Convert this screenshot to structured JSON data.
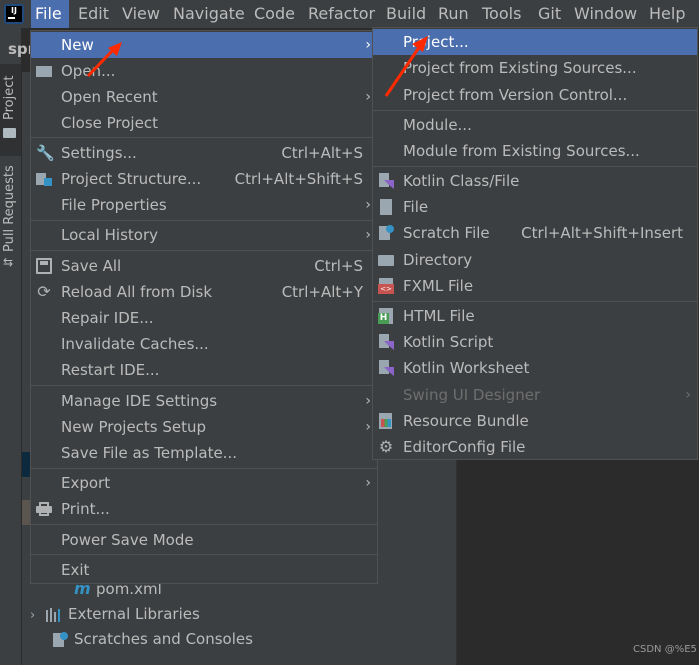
{
  "menubar": {
    "items": [
      "File",
      "Edit",
      "View",
      "Navigate",
      "Code",
      "Refactor",
      "Build",
      "Run",
      "Tools",
      "Git",
      "Window",
      "Help"
    ],
    "active": "File"
  },
  "project": {
    "name": "spr"
  },
  "left_strip": {
    "project_tab": "Project",
    "pull_requests_tab": "Pull Requests"
  },
  "tree": {
    "pom": "pom.xml",
    "external_libraries": "External Libraries",
    "scratches": "Scratches and Consoles"
  },
  "file_menu": {
    "new": "New",
    "open": "Open...",
    "open_recent": "Open Recent",
    "close_project": "Close Project",
    "settings": "Settings...",
    "settings_sc": "Ctrl+Alt+S",
    "project_structure": "Project Structure...",
    "project_structure_sc": "Ctrl+Alt+Shift+S",
    "file_properties": "File Properties",
    "local_history": "Local History",
    "save_all": "Save All",
    "save_all_sc": "Ctrl+S",
    "reload_all": "Reload All from Disk",
    "reload_all_sc": "Ctrl+Alt+Y",
    "repair_ide": "Repair IDE...",
    "invalidate_caches": "Invalidate Caches...",
    "restart_ide": "Restart IDE...",
    "manage_ide_settings": "Manage IDE Settings",
    "new_projects_setup": "New Projects Setup",
    "save_as_template": "Save File as Template...",
    "export": "Export",
    "print": "Print...",
    "power_save": "Power Save Mode",
    "exit": "Exit"
  },
  "new_menu": {
    "project": "Project...",
    "from_existing": "Project from Existing Sources...",
    "from_vcs": "Project from Version Control...",
    "module": "Module...",
    "module_existing": "Module from Existing Sources...",
    "kotlin_class": "Kotlin Class/File",
    "file": "File",
    "scratch_file": "Scratch File",
    "scratch_file_sc": "Ctrl+Alt+Shift+Insert",
    "directory": "Directory",
    "fxml_file": "FXML File",
    "html_file": "HTML File",
    "kotlin_script": "Kotlin Script",
    "kotlin_worksheet": "Kotlin Worksheet",
    "swing_ui_designer": "Swing UI Designer",
    "resource_bundle": "Resource Bundle",
    "editorconfig": "EditorConfig File"
  },
  "watermark": "CSDN @%E5",
  "colors": {
    "highlight": "#4b6eaf",
    "menu_bg": "#3c3f41",
    "arrow": "#ff2a00"
  }
}
